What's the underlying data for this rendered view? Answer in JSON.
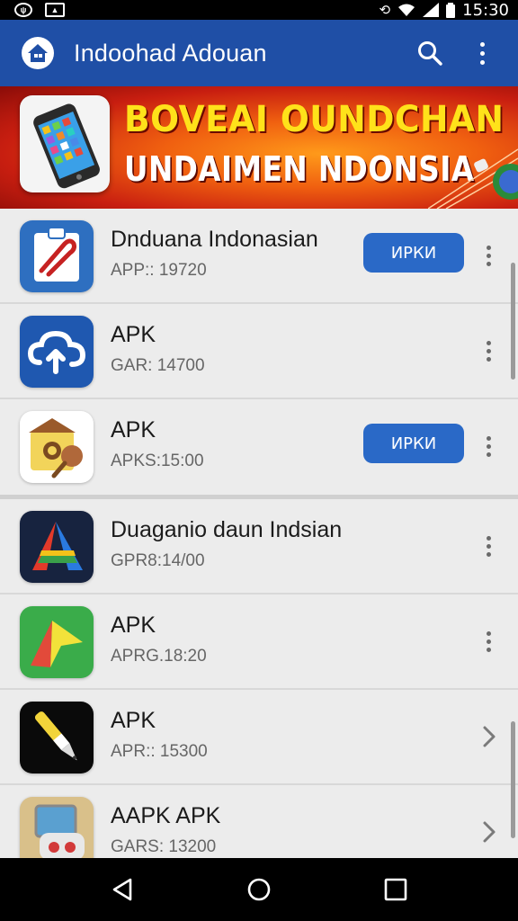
{
  "status_bar": {
    "time": "15:30",
    "left_icons": [
      "notification-icon",
      "image-icon"
    ],
    "right_icons": [
      "sync-icon",
      "wifi-icon",
      "signal-icon",
      "battery-icon"
    ]
  },
  "app_bar": {
    "title": "Indoohad Adouan",
    "actions": [
      "search-icon",
      "more-vert-icon"
    ]
  },
  "banner": {
    "line1": "BOVEAI OUNDCHAN",
    "line2": "UNDAIMEN NDONSIA"
  },
  "apps": [
    {
      "title": "Dnduana Indonasian",
      "subtitle": "APP:: 19720",
      "button": "ИРКИ",
      "trailing": "more"
    },
    {
      "title": "APK",
      "subtitle": "GAR: 14700",
      "button": "",
      "trailing": "more"
    },
    {
      "title": "APK",
      "subtitle": "APKS:15:00",
      "button": "ИРКИ",
      "trailing": "more"
    },
    {
      "title": "Duaganio daun Indsian",
      "subtitle": "GPR8:14/00",
      "button": "",
      "trailing": "more"
    },
    {
      "title": "APK",
      "subtitle": "APRG.18:20",
      "button": "",
      "trailing": "more"
    },
    {
      "title": "APK",
      "subtitle": "APR:: 15300",
      "button": "",
      "trailing": "chevron"
    },
    {
      "title": "AAPK APK",
      "subtitle": "GARS: 13200",
      "button": "",
      "trailing": "chevron"
    }
  ],
  "nav_bar": {
    "buttons": [
      "back-icon",
      "home-icon",
      "recents-icon"
    ]
  },
  "colors": {
    "app_bar": "#1f4fa6",
    "action_button": "#2a69c7",
    "banner_yellow": "#ffe21a",
    "banner_red": "#c81e10"
  }
}
